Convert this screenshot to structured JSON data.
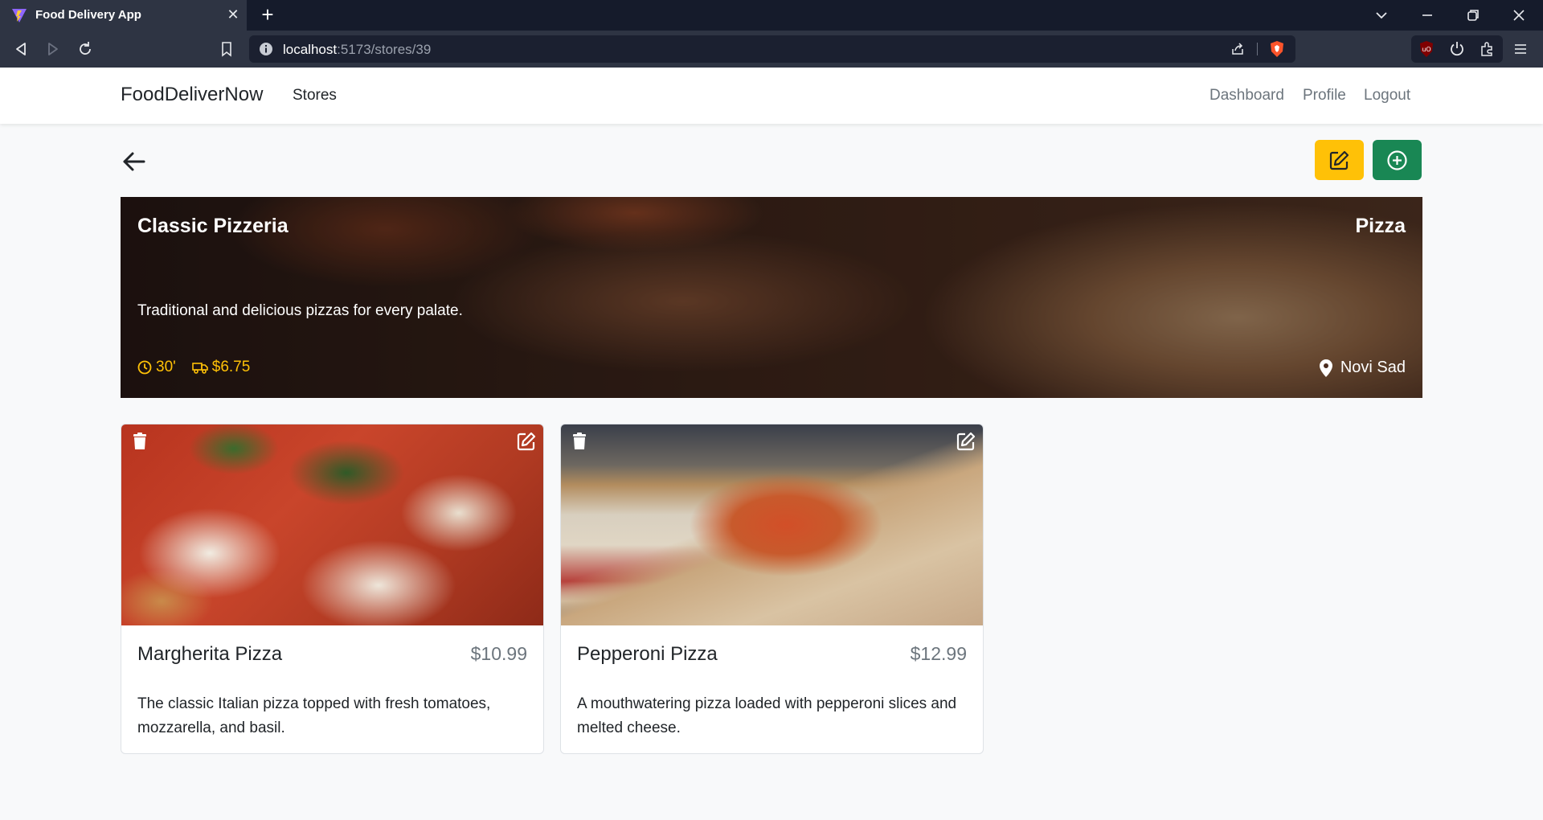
{
  "browser": {
    "tab_title": "Food Delivery App",
    "tab_close": "✕",
    "new_tab": "+",
    "url_host": "localhost",
    "url_path": ":5173/stores/39",
    "icons": [
      "brave-logo-icon",
      "back-icon",
      "forward-icon",
      "reload-icon",
      "bookmark-icon",
      "site-info-icon",
      "share-icon",
      "brave-shield-icon",
      "ublock-icon",
      "power-icon",
      "extensions-icon",
      "menu-icon",
      "minimize-icon",
      "maximize-icon",
      "close-window-icon",
      "tab-list-icon"
    ]
  },
  "navbar": {
    "brand": "FoodDeliverNow",
    "links": {
      "stores": "Stores",
      "dashboard": "Dashboard",
      "profile": "Profile",
      "logout": "Logout"
    }
  },
  "actions": {
    "edit_store_color": "#ffc107",
    "add_item_color": "#198754"
  },
  "store": {
    "name": "Classic Pizzeria",
    "category": "Pizza",
    "description": "Traditional and delicious pizzas for every palate.",
    "delivery_time": "30'",
    "delivery_fee": "$6.75",
    "location": "Novi Sad",
    "accent_color": "#ffc107"
  },
  "items": [
    {
      "name": "Margherita Pizza",
      "price": "$10.99",
      "description": "The classic Italian pizza topped with fresh tomatoes, mozzarella, and basil."
    },
    {
      "name": "Pepperoni Pizza",
      "price": "$12.99",
      "description": "A mouthwatering pizza loaded with pepperoni slices and melted cheese."
    }
  ]
}
